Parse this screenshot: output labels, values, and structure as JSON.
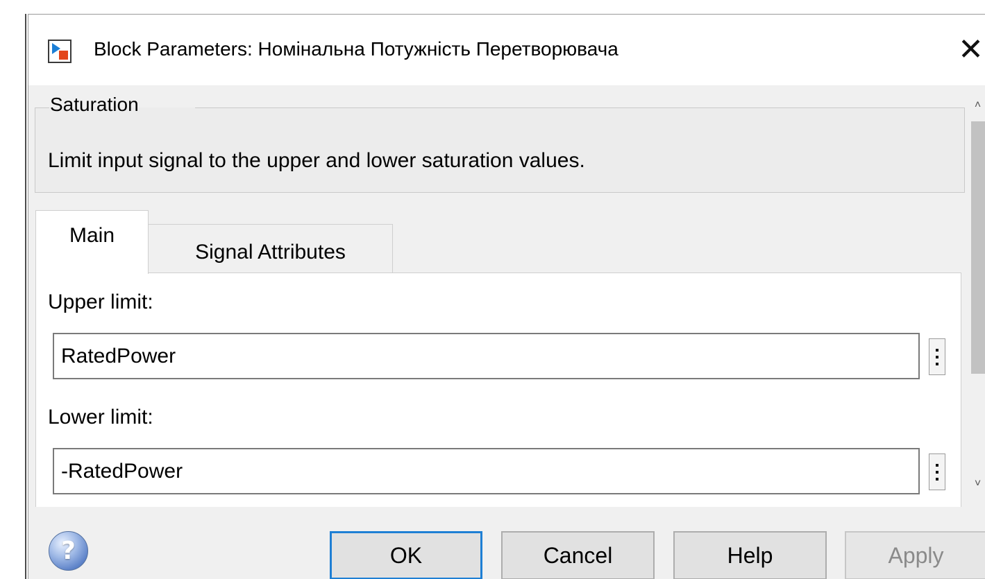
{
  "window": {
    "title": "Block Parameters: Номінальна Потужність Перетворювача",
    "close_symbol": "✕"
  },
  "group": {
    "legend": "Saturation",
    "description": "Limit input signal to the upper and lower saturation values."
  },
  "tabs": [
    {
      "label": "Main",
      "active": true
    },
    {
      "label": "Signal Attributes",
      "active": false
    }
  ],
  "fields": {
    "upper": {
      "label": "Upper limit:",
      "value": "RatedPower"
    },
    "lower": {
      "label": "Lower limit:",
      "value": "-RatedPower"
    }
  },
  "buttons": {
    "help_icon": "?",
    "ok": "OK",
    "cancel": "Cancel",
    "help": "Help",
    "apply": "Apply",
    "apply_enabled": false
  },
  "icons": {
    "app_icon": "simulink-block-icon",
    "help_icon": "question-circle-icon",
    "more_icon": "vertical-ellipsis-icon",
    "scroll_up": "chevron-up-icon",
    "scroll_down": "chevron-down-icon"
  },
  "colors": {
    "focus_border": "#1e7fd4",
    "icon_blue": "#1c7fd6",
    "icon_orange": "#e3461b"
  }
}
